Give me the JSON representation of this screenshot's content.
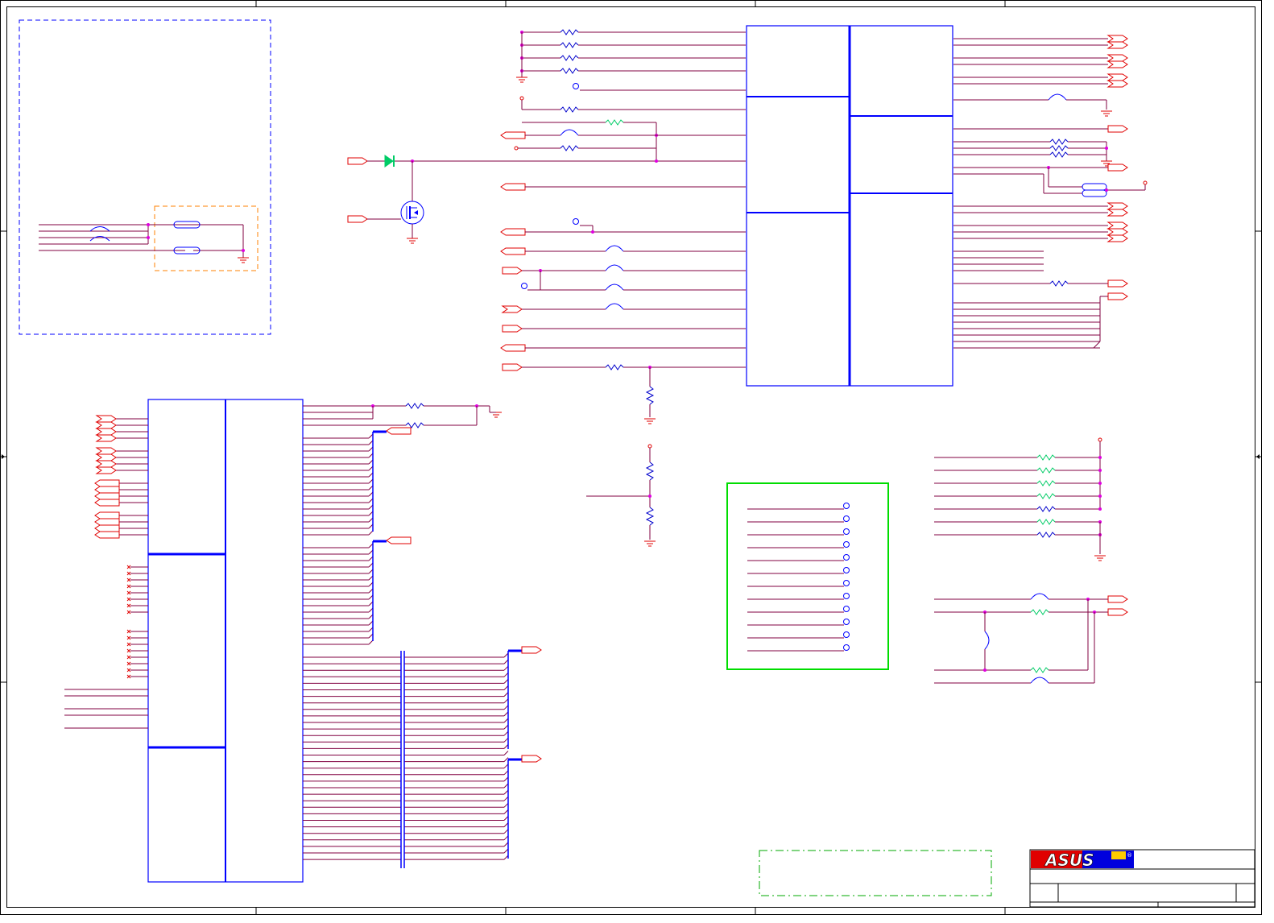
{
  "title_block": {
    "brand": "ASUS",
    "registered_mark": "®"
  },
  "colors": {
    "frame": "#000000",
    "wire": "#800040",
    "wire_alt": "#e00000",
    "component": "#0000ff",
    "junction": "#e000e0",
    "port": "#e00000",
    "zone_blue": "#0000ff",
    "zone_orange": "#ff8000",
    "zone_green": "#00dd00",
    "note_green": "#00aa00",
    "logo_red": "#e00000",
    "logo_blue": "#0000dd",
    "logo_yellow": "#ffcc00"
  },
  "icons": [
    "ground-icon",
    "resistor-icon",
    "mosfet-icon",
    "diode-icon",
    "jumper-icon",
    "test-point-icon",
    "port-icon"
  ]
}
